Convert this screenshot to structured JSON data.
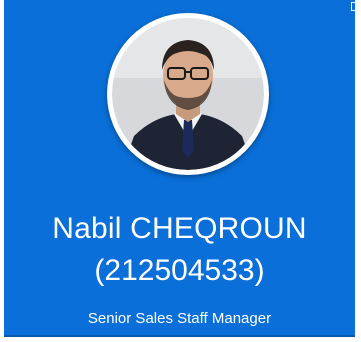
{
  "profile": {
    "name": "Nabil CHEQROUN",
    "phone": "(212504533)",
    "role": "Senior Sales Staff Manager",
    "avatar_icon": "user-photo"
  },
  "colors": {
    "card_background": "#0a6fd8",
    "text": "#ffffff"
  }
}
